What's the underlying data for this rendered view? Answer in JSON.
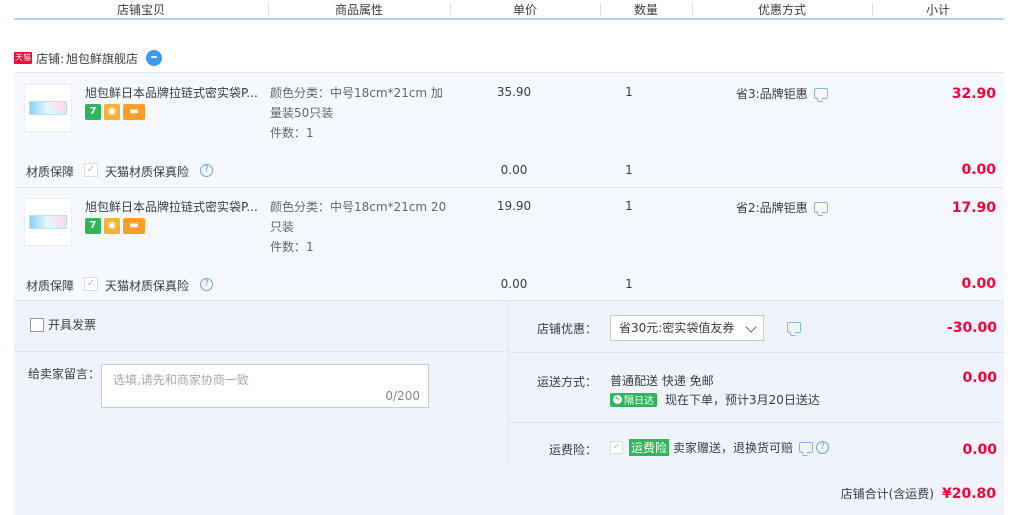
{
  "columns": [
    "店铺宝贝",
    "商品属性",
    "单价",
    "数量",
    "优惠方式",
    "小计"
  ],
  "shop": {
    "platform_badge": "天猫",
    "label": "店铺:",
    "name": "旭包鲜旗舰店"
  },
  "items": [
    {
      "title": "旭包鲜日本品牌拉链式密实袋P...",
      "attr_line1": "颜色分类：中号18cm*21cm 加",
      "attr_line2": "量装50只装",
      "attr_count": "件数：1",
      "price": "35.90",
      "qty": "1",
      "promo": "省3:品牌钜惠",
      "subtotal": "32.90"
    },
    {
      "title": "旭包鲜日本品牌拉链式密实袋P...",
      "attr_line1": "颜色分类：中号18cm*21cm 20",
      "attr_line2": "只装",
      "attr_count": "件数：1",
      "price": "19.90",
      "qty": "1",
      "promo": "省2:品牌钜惠",
      "subtotal": "17.90"
    }
  ],
  "insurance": [
    {
      "label": "材质保障",
      "name": "天猫材质保真险",
      "price": "0.00",
      "qty": "1",
      "subtotal": "0.00"
    },
    {
      "label": "材质保障",
      "name": "天猫材质保真险",
      "price": "0.00",
      "qty": "1",
      "subtotal": "0.00"
    }
  ],
  "invoice_label": "开具发票",
  "message": {
    "label": "给卖家留言：",
    "placeholder": "选填,请先和商家协商一致",
    "count": "0/200"
  },
  "shop_discount": {
    "label": "店铺优惠：",
    "selected": "省30元:密实袋值友券",
    "amount": "-30.00"
  },
  "shipping": {
    "label": "运送方式：",
    "method": "普通配送 快递 免邮",
    "badge": "隔日达",
    "eta": "现在下单，预计3月20日送达",
    "amount": "0.00"
  },
  "return_insurance": {
    "label": "运费险：",
    "tag": "运费险",
    "desc": "卖家赠送，退换货可赔",
    "amount": "0.00"
  },
  "total": {
    "label": "店铺合计(含运费)",
    "amount": "¥20.80"
  },
  "colors": {
    "accent": "#ff0036",
    "green": "#2fb65a",
    "panel": "#f5f8fe"
  },
  "icons": [
    "tmall-icon",
    "wangwang-icon",
    "message-icon",
    "question-icon",
    "checkbox-icon",
    "chevron-down-icon",
    "bolt-icon"
  ]
}
